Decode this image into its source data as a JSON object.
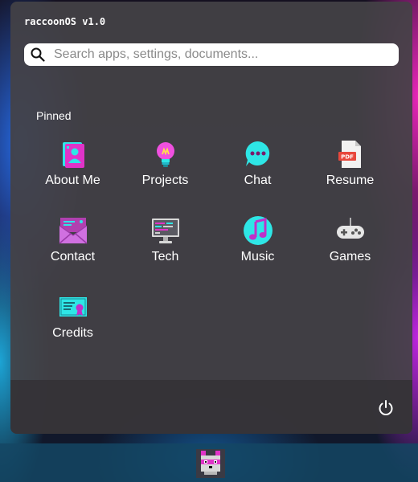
{
  "window": {
    "title": "raccoonOS v1.0"
  },
  "search": {
    "placeholder": "Search apps, settings, documents..."
  },
  "pinned": {
    "label": "Pinned",
    "apps": [
      {
        "label": "About Me",
        "icon": "profile-card-icon"
      },
      {
        "label": "Projects",
        "icon": "lightbulb-icon"
      },
      {
        "label": "Chat",
        "icon": "chat-bubble-icon"
      },
      {
        "label": "Resume",
        "icon": "pdf-document-icon"
      },
      {
        "label": "Contact",
        "icon": "mail-envelope-icon"
      },
      {
        "label": "Tech",
        "icon": "monitor-code-icon"
      },
      {
        "label": "Music",
        "icon": "music-note-icon"
      },
      {
        "label": "Games",
        "icon": "gamepad-icon"
      },
      {
        "label": "Credits",
        "icon": "certificate-icon"
      }
    ]
  },
  "footer": {
    "power_icon": "power-icon"
  },
  "taskbar": {
    "start_icon": "raccoon-logo-icon"
  },
  "colors": {
    "panel": "#444246",
    "accent_cyan": "#2ee6e6",
    "accent_magenta": "#e033c8",
    "search_bg": "#ffffff"
  }
}
